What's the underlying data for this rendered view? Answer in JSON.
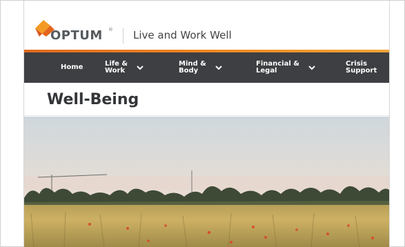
{
  "brand": {
    "logo_text": "OPTUM",
    "logo_mark": "®",
    "tagline": "Live and Work Well"
  },
  "nav": {
    "items": [
      {
        "label": "Home",
        "has_dropdown": false
      },
      {
        "label": "Life &\nWork",
        "has_dropdown": true
      },
      {
        "label": "Mind &\nBody",
        "has_dropdown": true
      },
      {
        "label": "Financial &\nLegal",
        "has_dropdown": true
      },
      {
        "label": "Crisis\nSupport",
        "has_dropdown": false
      }
    ]
  },
  "page": {
    "title": "Well-Being"
  },
  "colors": {
    "accent": "#f08a24",
    "nav_bg": "#3d3f42",
    "text": "#333538"
  },
  "icons": {
    "logo": "optum-logo-icon",
    "dropdown": "chevron-down-icon"
  }
}
